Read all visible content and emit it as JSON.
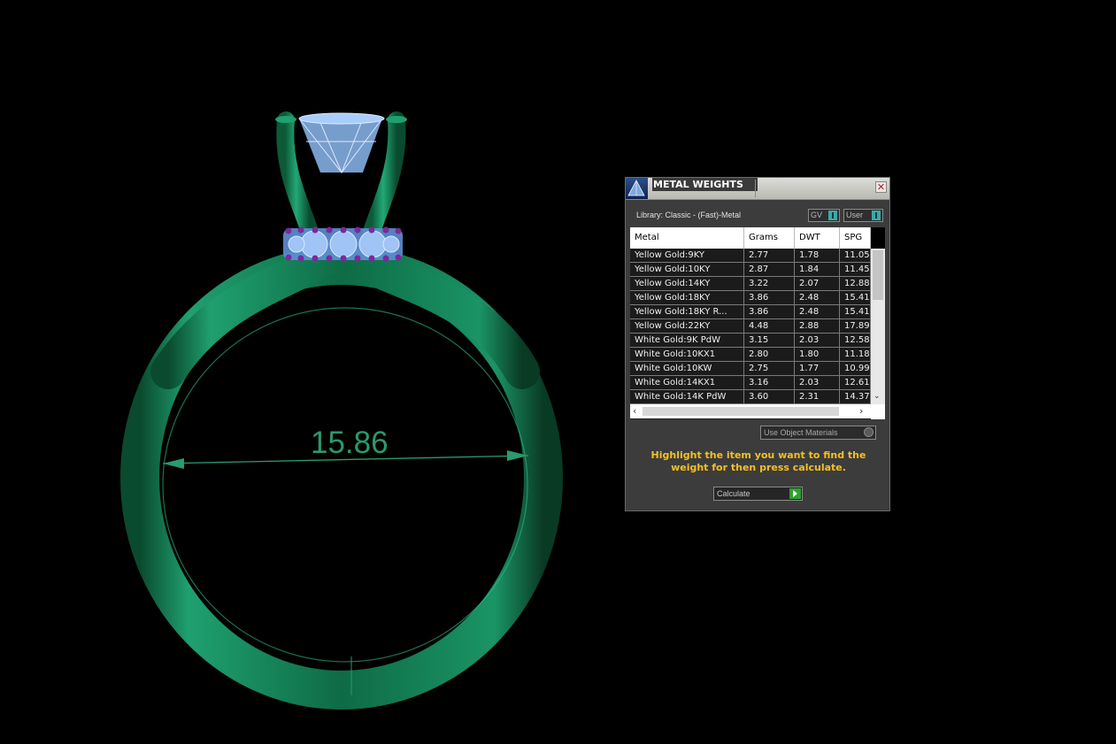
{
  "viewport": {
    "dimension_value": "15.86",
    "ring_color": "#1a7a4f",
    "stone_color": "#8cb8f0",
    "accent_stone_color": "#7a2a9a"
  },
  "panel": {
    "title": "METAL WEIGHTS",
    "close_icon": "close-icon",
    "library_label": "Library: Classic - (Fast)-Metal",
    "gv_label": "GV",
    "user_label": "User",
    "columns": [
      "Metal",
      "Grams",
      "DWT",
      "SPG"
    ],
    "rows": [
      [
        "Yellow Gold:9KY",
        "2.77",
        "1.78",
        "11.05"
      ],
      [
        "Yellow Gold:10KY",
        "2.87",
        "1.84",
        "11.45"
      ],
      [
        "Yellow Gold:14KY",
        "3.22",
        "2.07",
        "12.88"
      ],
      [
        "Yellow Gold:18KY",
        "3.86",
        "2.48",
        "15.41"
      ],
      [
        "Yellow Gold:18KY R...",
        "3.86",
        "2.48",
        "15.41"
      ],
      [
        "Yellow Gold:22KY",
        "4.48",
        "2.88",
        "17.89"
      ],
      [
        "White Gold:9K PdW",
        "3.15",
        "2.03",
        "12.58"
      ],
      [
        "White Gold:10KX1",
        "2.80",
        "1.80",
        "11.18"
      ],
      [
        "White Gold:10KW",
        "2.75",
        "1.77",
        "10.99"
      ],
      [
        "White Gold:14KX1",
        "3.16",
        "2.03",
        "12.61"
      ],
      [
        "White Gold:14K PdW",
        "3.60",
        "2.31",
        "14.37"
      ]
    ],
    "use_object_materials": "Use Object Materials",
    "instruction": "Highlight the item you want to find the weight for then press calculate.",
    "calculate_label": "Calculate"
  }
}
